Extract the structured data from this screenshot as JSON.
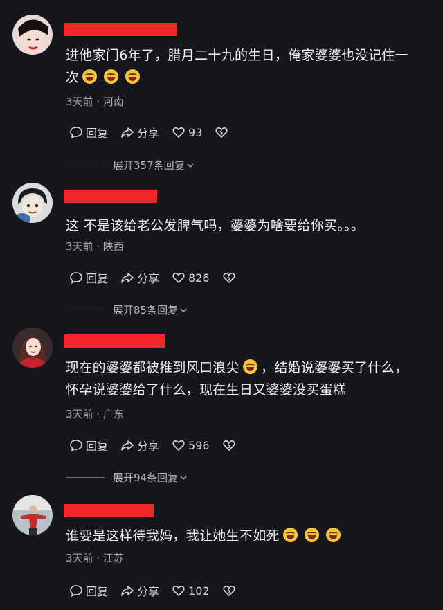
{
  "comments": [
    {
      "text_line1": "进他家门6年了，腊月二十九的生日，俺家婆婆也没记住一",
      "text_line2": "次",
      "meta": "3天前 · 河南",
      "reply_label": "回复",
      "share_label": "分享",
      "likes": "93",
      "expand": "展开357条回复"
    },
    {
      "text_line1": "这 不是该给老公发脾气吗，婆婆为啥要给你买。。。",
      "meta": "3天前 · 陕西",
      "reply_label": "回复",
      "share_label": "分享",
      "likes": "826",
      "expand": "展开85条回复"
    },
    {
      "text_line1a": "现在的婆婆都被推到风口浪尖",
      "text_line1b": "，结婚说婆婆买了什么，",
      "text_line2": "怀孕说婆婆给了什么，现在生日又婆婆没买蛋糕",
      "meta": "3天前 · 广东",
      "reply_label": "回复",
      "share_label": "分享",
      "likes": "596",
      "expand": "展开94条回复"
    },
    {
      "text_line1": "谁要是这样待我妈，我让她生不如死",
      "meta": "3天前 · 江苏",
      "reply_label": "回复",
      "share_label": "分享",
      "likes": "102"
    }
  ],
  "colors": {
    "background": "#16171c",
    "redacted_name": "#f0262b"
  },
  "icons": [
    "comment-reply-icon",
    "share-arrow-icon",
    "heart-icon",
    "broken-heart-icon",
    "laughing-tears-emoji",
    "chevron-down-icon"
  ]
}
